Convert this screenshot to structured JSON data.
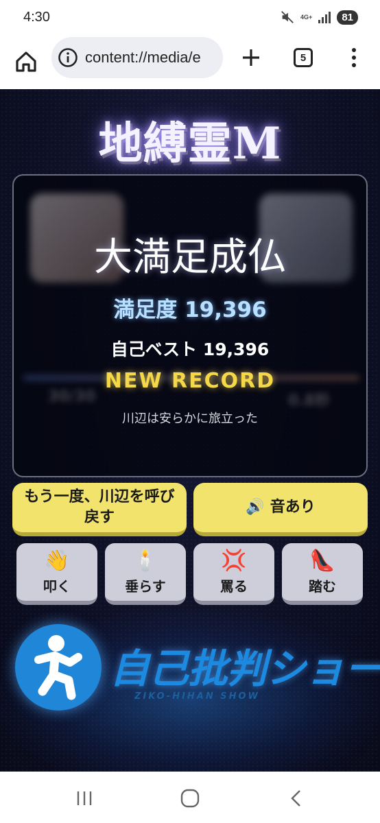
{
  "status_bar": {
    "time": "4:30",
    "network": "4G+",
    "battery": "81"
  },
  "browser": {
    "url": "content://media/e",
    "tab_count": "5",
    "icons": [
      "home-icon",
      "info-icon",
      "plus-icon",
      "tabs-icon",
      "more-vert-icon"
    ]
  },
  "game": {
    "title": "地縛霊M",
    "result_title": "大満足成仏",
    "score_text": "満足度 19,396",
    "best_text": "自己ベスト 19,396",
    "record_text": "NEW RECORD",
    "subtitle": "川辺は安らかに旅立った",
    "buttons": {
      "revive": "もう一度、川辺を呼び戻す",
      "sound_icon": "🔊",
      "sound": "音あり"
    },
    "actions": [
      {
        "emoji": "👋",
        "label": "叩く",
        "icon": "waving-hand-icon"
      },
      {
        "emoji": "🕯️",
        "label": "垂らす",
        "icon": "candle-icon"
      },
      {
        "emoji": "💢",
        "label": "罵る",
        "icon": "anger-icon"
      },
      {
        "emoji": "👠",
        "label": "踏む",
        "icon": "high-heel-icon"
      }
    ]
  },
  "logo": {
    "text": "自己批判ショー",
    "subtext": "ZIKO-HIHAN SHOW"
  },
  "colors": {
    "accent_yellow": "#f1e36b",
    "score_blue": "#b8e0ff",
    "record_gold": "#f5d84a",
    "logo_blue": "#1c8ae0",
    "background": "#0d0f24"
  }
}
